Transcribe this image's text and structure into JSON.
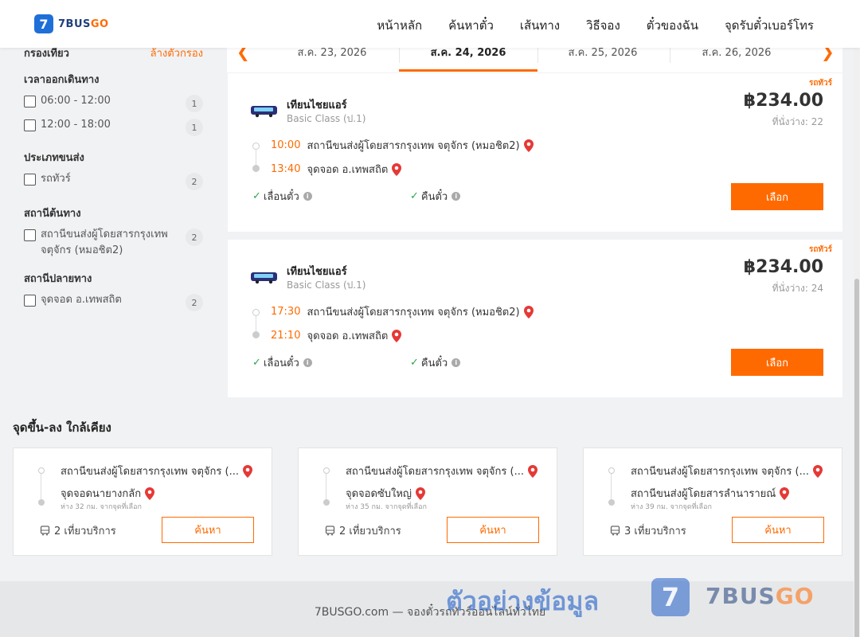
{
  "header": {
    "logo_mark": "7",
    "logo_text_a": "7BUS",
    "logo_text_b": "GO",
    "nav": [
      "หน้าหลัก",
      "ค้นหาตั๋ว",
      "เส้นทาง",
      "วิธีจอง",
      "ตั๋วของฉัน",
      "จุดรับตั๋วเบอร์โทร"
    ]
  },
  "sidebar": {
    "title": "กรองเที่ยว",
    "clear": "ล้างตัวกรอง",
    "groups": [
      {
        "title": "เวลาออกเดินทาง",
        "options": [
          {
            "label": "06:00 - 12:00",
            "count": "1"
          },
          {
            "label": "12:00 - 18:00",
            "count": "1"
          }
        ]
      },
      {
        "title": "ประเภทขนส่ง",
        "options": [
          {
            "label": "รถทัวร์",
            "count": "2"
          }
        ]
      },
      {
        "title": "สถานีต้นทาง",
        "options": [
          {
            "label": "สถานีขนส่งผู้โดยสารกรุงเทพ จตุจักร (หมอชิต2)",
            "count": "2"
          }
        ]
      },
      {
        "title": "สถานีปลายทาง",
        "options": [
          {
            "label": "จุดจอด อ.เทพสถิต",
            "count": "2"
          }
        ]
      }
    ]
  },
  "dates": {
    "prev": "‹",
    "next": "›",
    "tabs": [
      "ส.ค. 23, 2026",
      "ส.ค. 24, 2026",
      "ส.ค. 25, 2026",
      "ส.ค. 26, 2026"
    ],
    "active_index": 1
  },
  "trips": [
    {
      "tag": "รถทัวร์",
      "operator": "เทียนไชยแอร์",
      "class": "Basic Class (ป.1)",
      "price": "฿234.00",
      "seats": "ที่นั่งว่าง: 22",
      "dep_time": "10:00",
      "dep_station": "สถานีขนส่งผู้โดยสารกรุงเทพ จตุจักร (หมอชิต2)",
      "arr_time": "13:40",
      "arr_station": "จุดจอด อ.เทพสถิต",
      "feature1": "เลื่อนตั๋ว",
      "feature2": "คืนตั๋ว",
      "button": "เลือก"
    },
    {
      "tag": "รถทัวร์",
      "operator": "เทียนไชยแอร์",
      "class": "Basic Class (ป.1)",
      "price": "฿234.00",
      "seats": "ที่นั่งว่าง: 24",
      "dep_time": "17:30",
      "dep_station": "สถานีขนส่งผู้โดยสารกรุงเทพ จตุจักร (หมอชิต2)",
      "arr_time": "21:10",
      "arr_station": "จุดจอด อ.เทพสถิต",
      "feature1": "เลื่อนตั๋ว",
      "feature2": "คืนตั๋ว",
      "button": "เลือก"
    }
  ],
  "nearby": {
    "title": "จุดขึ้น-ลง ใกล้เคียง",
    "cards": [
      {
        "from": "สถานีขนส่งผู้โดยสารกรุงเทพ จตุจักร (...",
        "to": "จุดจอดนายางกลัก",
        "dist": "ห่าง 32 กม. จากจุดที่เลือก",
        "trips": "2 เที่ยวบริการ",
        "button": "ค้นหา"
      },
      {
        "from": "สถานีขนส่งผู้โดยสารกรุงเทพ จตุจักร (...",
        "to": "จุดจอดซับใหญ่",
        "dist": "ห่าง 35 กม. จากจุดที่เลือก",
        "trips": "2 เที่ยวบริการ",
        "button": "ค้นหา"
      },
      {
        "from": "สถานีขนส่งผู้โดยสารกรุงเทพ จตุจักร (...",
        "to": "สถานีขนส่งผู้โดยสารลำนารายณ์",
        "dist": "ห่าง 39 กม. จากจุดที่เลือก",
        "trips": "3 เที่ยวบริการ",
        "button": "ค้นหา"
      }
    ]
  },
  "footer": {
    "text": "7BUSGO.com — จองตั๋วรถทัวร์ออนไลน์ทั่วไทย"
  },
  "watermark": {
    "text": "ตัวอย่างข้อมูล",
    "logo_mark": "7",
    "logo_text_a": "7BUS",
    "logo_text_b": "GO"
  },
  "colors": {
    "accent": "#ff6a00",
    "brand_blue": "#1f6fd8"
  }
}
